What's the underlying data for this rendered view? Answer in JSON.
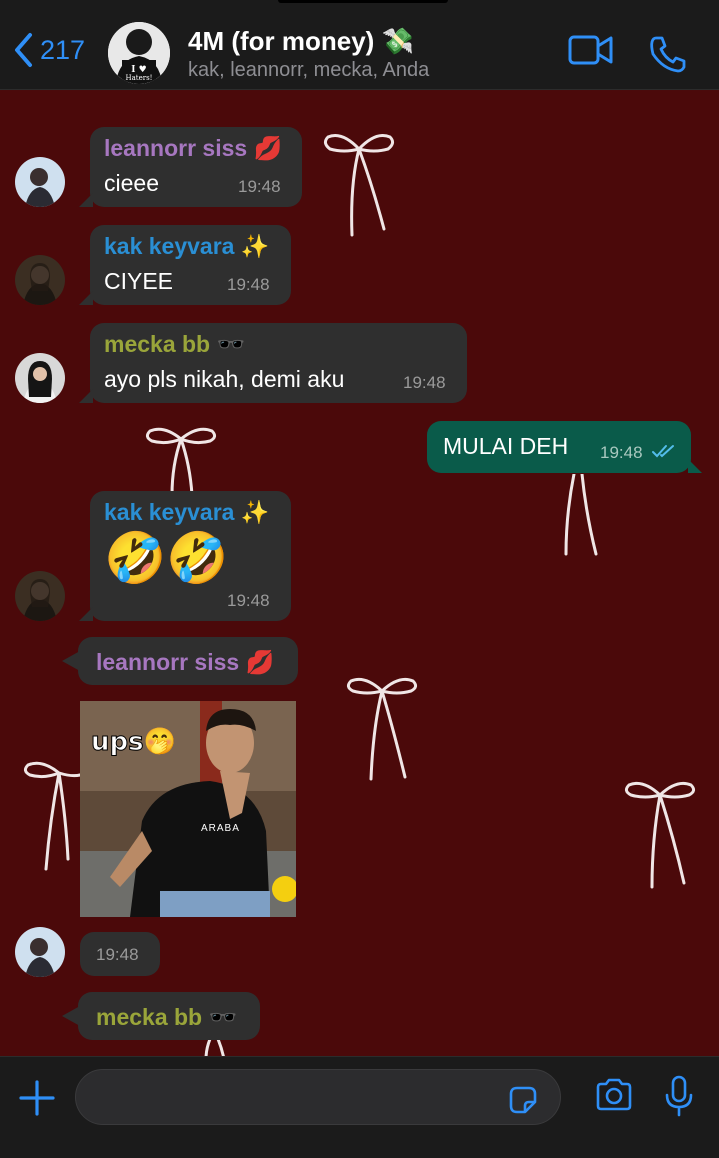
{
  "header": {
    "back_count": "217",
    "group_name": "4M (for money) 💸",
    "members": "kak, leannorr, mecka, Anda",
    "avatar_text": "I ♥ Haters!"
  },
  "messages": [
    {
      "sender": "leannorr siss 💋",
      "text": "cieee",
      "time": "19:48"
    },
    {
      "sender": "kak keyvara ✨",
      "text": "CIYEE",
      "time": "19:48"
    },
    {
      "sender": "mecka bb 🕶️",
      "text": "ayo pls nikah, demi aku",
      "time": "19:48"
    },
    {
      "sender": "",
      "text": "MULAI DEH",
      "time": "19:48",
      "outgoing": true
    },
    {
      "sender": "kak keyvara ✨",
      "text": "🤣🤣",
      "time": "19:48"
    },
    {
      "sender": "leannorr siss 💋",
      "sticker_text": "ups🤭",
      "shirt_text": "ARABA",
      "time": "19:48"
    },
    {
      "sender": "mecka bb 🕶️"
    }
  ],
  "colors": {
    "accent": "#2f8ff7",
    "chat_bg": "#4b090a",
    "outgoing_bubble": "#0a5b4a",
    "incoming_bubble": "#2f2f2f"
  },
  "icons": [
    "back-chevron-icon",
    "video-call-icon",
    "phone-call-icon",
    "plus-icon",
    "sticker-icon",
    "camera-icon",
    "microphone-icon",
    "double-check-icon"
  ]
}
